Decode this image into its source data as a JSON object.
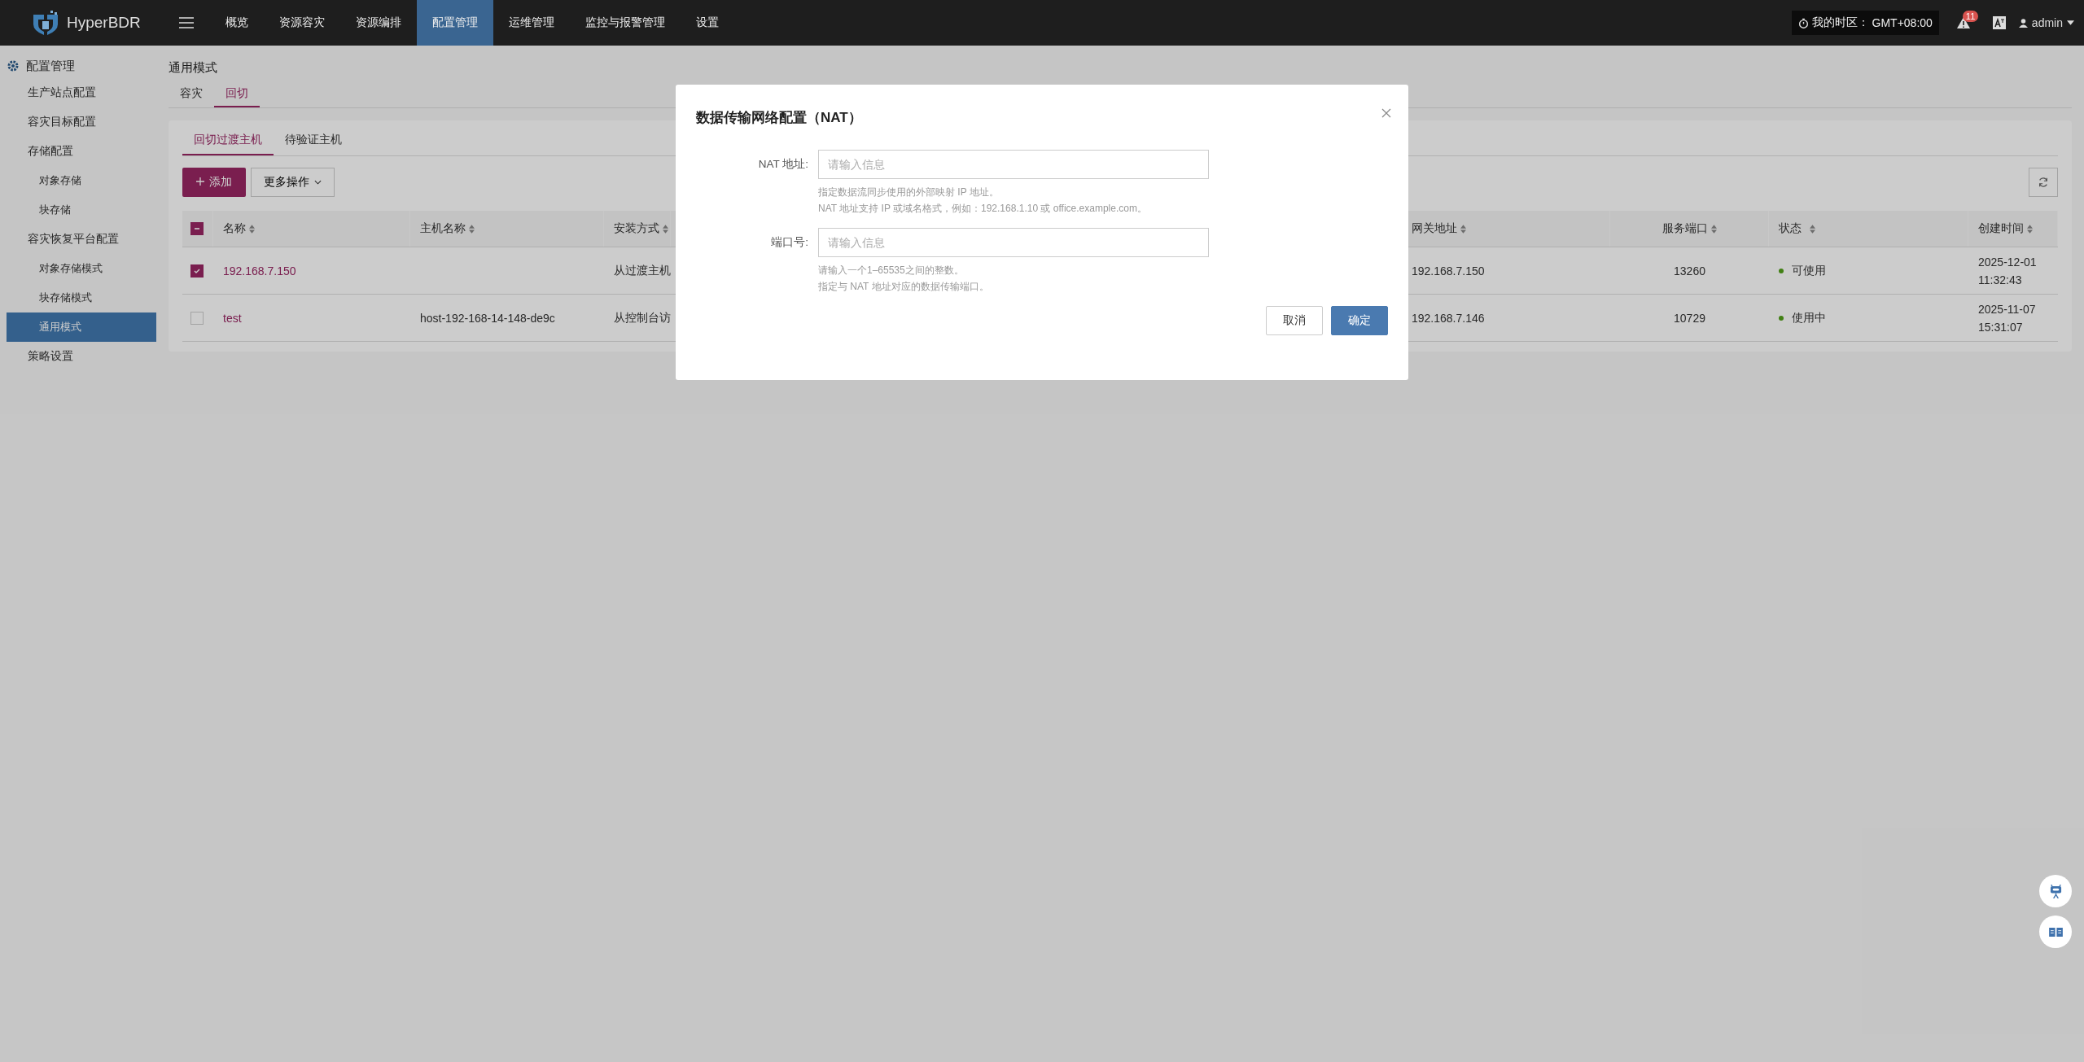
{
  "top_bar": {
    "logo": "HyperBDR",
    "nav": [
      {
        "label": "概览",
        "selected": false
      },
      {
        "label": "资源容灾",
        "selected": false
      },
      {
        "label": "资源编排",
        "selected": false
      },
      {
        "label": "配置管理",
        "selected": true
      },
      {
        "label": "运维管理",
        "selected": false
      },
      {
        "label": "监控与报警管理",
        "selected": false
      },
      {
        "label": "设置",
        "selected": false
      }
    ],
    "timezone": {
      "label": "我的时区：",
      "value": "GMT+08:00"
    },
    "alert_count": "11",
    "user": "admin"
  },
  "sidebar": {
    "title": "配置管理",
    "items": [
      {
        "label": "生产站点配置",
        "selected": false
      },
      {
        "label": "容灾目标配置",
        "selected": false
      },
      {
        "label": "存储配置",
        "selected": false,
        "children": [
          {
            "label": "对象存储",
            "selected": false
          },
          {
            "label": "块存储",
            "selected": false
          }
        ]
      },
      {
        "label": "容灾恢复平台配置",
        "selected": false,
        "children": [
          {
            "label": "对象存储模式",
            "selected": false
          },
          {
            "label": "块存储模式",
            "selected": false
          },
          {
            "label": "通用模式",
            "selected": true
          }
        ]
      },
      {
        "label": "策略设置",
        "selected": false
      }
    ]
  },
  "page": {
    "title": "通用模式",
    "tabs": [
      {
        "label": "容灾",
        "selected": false
      },
      {
        "label": "回切",
        "selected": true
      }
    ],
    "subtabs": [
      {
        "label": "回切过渡主机",
        "selected": true
      },
      {
        "label": "待验证主机",
        "selected": false
      }
    ],
    "add_button": "添加",
    "more_button": "更多操作",
    "table": {
      "all_checkbox": {
        "indeterminate": true
      },
      "columns": [
        {
          "label": "名称"
        },
        {
          "label": "主机名称"
        },
        {
          "label": "安装方式"
        },
        {
          "label": "网关地址"
        },
        {
          "label": "服务端口"
        },
        {
          "label": "状态"
        },
        {
          "label": "创建时间"
        }
      ],
      "rows": [
        {
          "selected": true,
          "name": "192.168.7.150",
          "host": "",
          "install": "从过渡主机",
          "gateway": "192.168.7.150",
          "port": "13260",
          "status": "可使用",
          "created": "2025-12-01 11:32:43"
        },
        {
          "selected": false,
          "name": "test",
          "host": "host-192-168-14-148-de9c",
          "install": "从控制台访",
          "gateway": "192.168.7.146",
          "port": "10729",
          "status": "使用中",
          "created": "2025-11-07 15:31:07"
        }
      ]
    }
  },
  "modal": {
    "title": "数据传输网络配置（NAT）",
    "fields": [
      {
        "label": "NAT 地址:",
        "placeholder": "请输入信息",
        "hints": [
          "指定数据流同步使用的外部映射 IP 地址。",
          "NAT 地址支持 IP 或域名格式，例如：192.168.1.10 或 office.example.com。"
        ]
      },
      {
        "label": "端口号:",
        "placeholder": "请输入信息",
        "hints": [
          "请输入一个1–65535之间的整数。",
          "指定与 NAT 地址对应的数据传输端口。"
        ]
      }
    ],
    "cancel": "取消",
    "ok": "确定"
  }
}
